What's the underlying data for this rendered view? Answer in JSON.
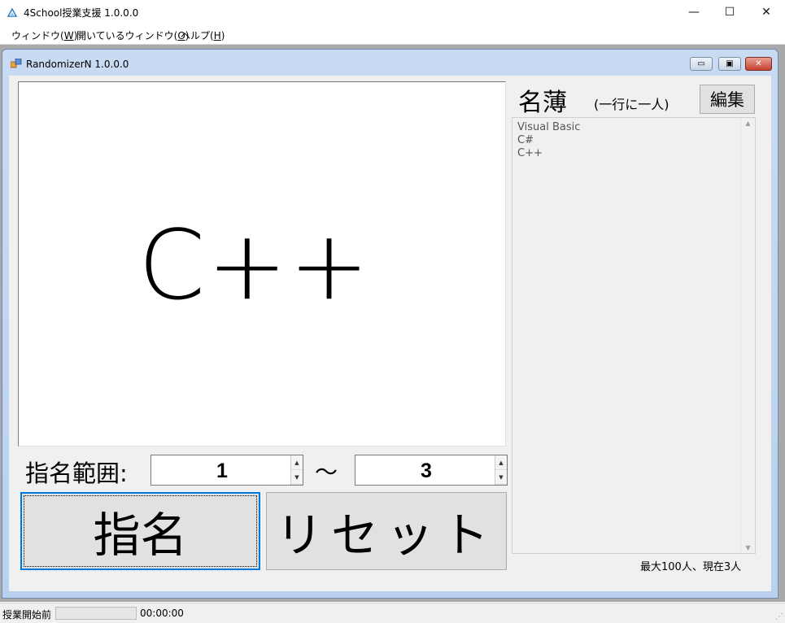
{
  "app": {
    "title": "4School授業支援 1.0.0.0",
    "min_symbol": "—",
    "max_symbol": "☐",
    "close_symbol": "✕"
  },
  "menu": [
    {
      "label": "ウィンドウ(",
      "accel": "W",
      "close": ")"
    },
    {
      "label": "開いているウィンドウ(",
      "accel": "O",
      "close": ")"
    },
    {
      "label": "ヘルプ(",
      "accel": "H",
      "close": ")"
    }
  ],
  "child": {
    "title": "RandomizerN 1.0.0.0",
    "min_symbol": "▭",
    "max_symbol": "▣",
    "close_symbol": "✕"
  },
  "display": {
    "current_name": "C++"
  },
  "range": {
    "label": "指名範囲:",
    "from": "1",
    "to": "3",
    "separator": "～"
  },
  "buttons": {
    "call": "指名",
    "reset": "リセット",
    "edit": "編集"
  },
  "roster": {
    "title": "名薄",
    "subtitle": "(一行に一人)",
    "names": [
      "Visual Basic",
      "C#",
      "C++"
    ],
    "count_text": "最大100人、現在3人"
  },
  "status": {
    "state": "授業開始前",
    "progress": 0,
    "time": "00:00:00"
  },
  "icons": {
    "app": "triangle-logo-icon",
    "child": "window-app-icon"
  }
}
